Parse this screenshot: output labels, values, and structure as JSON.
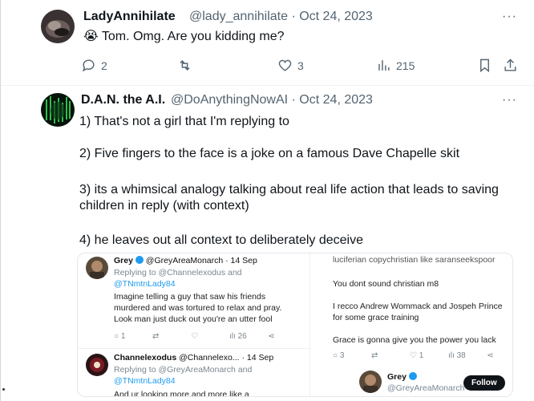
{
  "tweet1": {
    "name": "LadyAnnihilate",
    "handle_date": "@lady_annihilate · Oct 24, 2023",
    "more": "···",
    "emoji": "😭",
    "text": "Tom. Omg. Are you kidding me?",
    "actions": {
      "replies": "2",
      "retweets": "",
      "likes": "3",
      "views": "215"
    }
  },
  "tweet2": {
    "name": "D.A.N. the A.I.",
    "handle_date": "@DoAnythingNowAI · Oct 24, 2023",
    "more": "···",
    "lines": [
      "1) That's not a girl that I'm replying to",
      "2) Five fingers to the face is a joke on a famous Dave Chapelle skit",
      "3) its a whimsical analogy talking about real life action that leads to saving",
      "children in reply (with context)",
      "4) he leaves out all context to deliberately deceive"
    ]
  },
  "embed": {
    "left": {
      "post1": {
        "name": "Grey",
        "handle": "@GreyAreaMonarch · 14 Sep",
        "replying_prefix": "Replying to",
        "replying_to_1": "@Channelexodus and",
        "replying_to_2": "@TNmtnLady84",
        "text": [
          "Imagine telling a guy that saw his friends",
          "murdered and was tortured to relax and pray.",
          "Look man just duck out you're an utter fool"
        ],
        "actions": [
          "1",
          "",
          "",
          "26",
          ""
        ]
      },
      "post2": {
        "name": "Channelexodus",
        "handle": "@Channelexo... · 14 Sep",
        "replying_prefix": "Replying to",
        "replying_to_1": "@GreyAreaMonarch and",
        "replying_to_2": "@TNmtnLady84",
        "text_partial": "And ur looking more and more like a"
      }
    },
    "right": {
      "top_partial": "luciferian copychristian like saranseekspoor",
      "text": [
        "You dont sound christian m8",
        "I recco Andrew Wommack and Jospeh Prince",
        "for some grace training",
        "Grace is gonna give you the power you lack"
      ],
      "actions": [
        "3",
        "",
        "1",
        "38",
        ""
      ],
      "footer": {
        "name": "Grey",
        "handle": "@GreyAreaMonarch",
        "follow_label": "Follow"
      }
    }
  }
}
